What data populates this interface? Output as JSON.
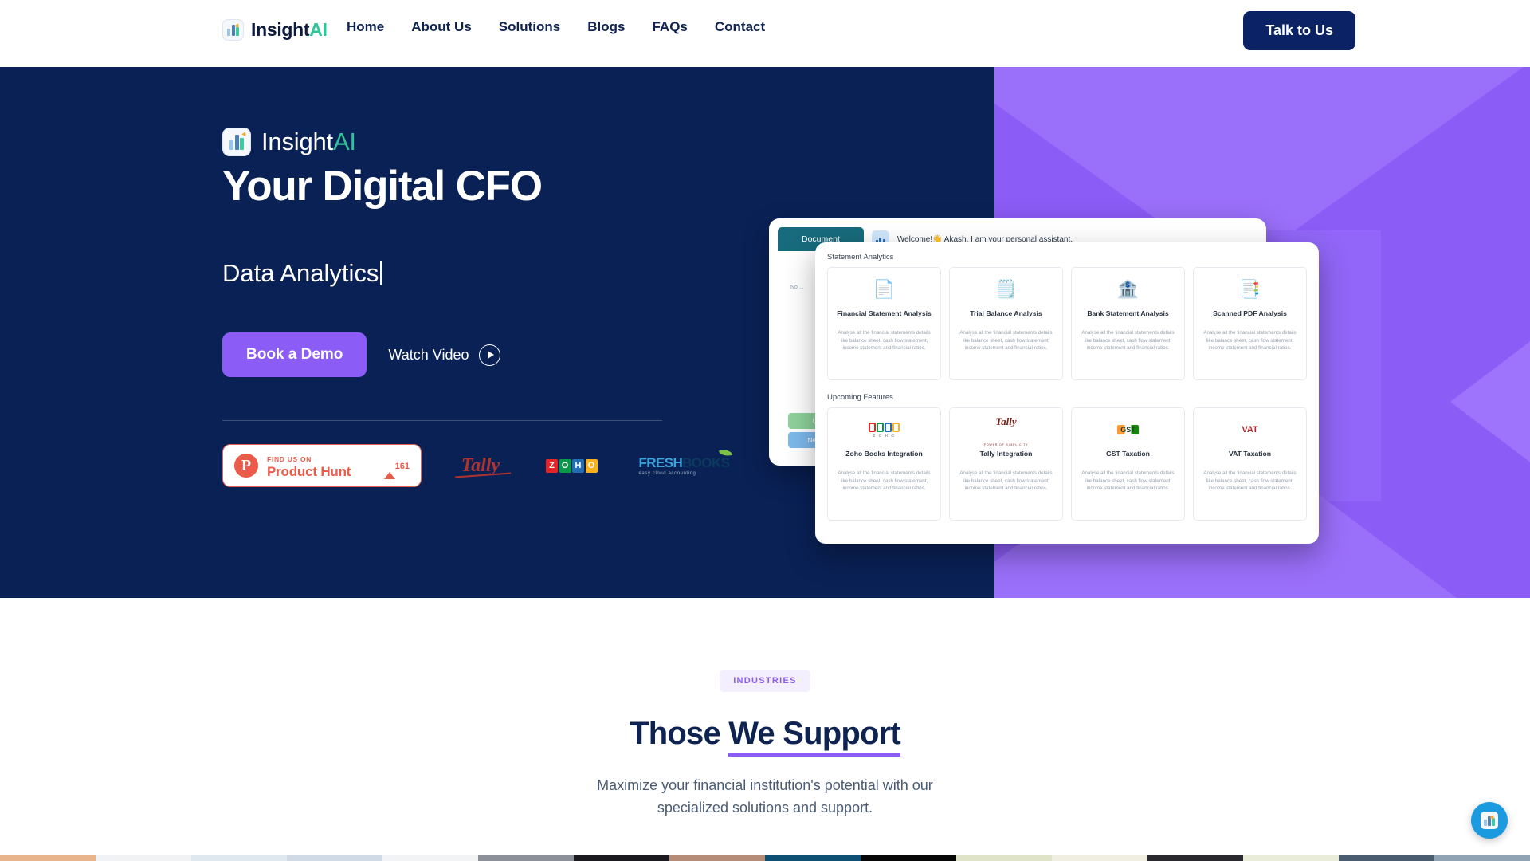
{
  "brand": {
    "name_main": "Insight",
    "name_accent": "AI"
  },
  "nav": {
    "links": [
      {
        "label": "Home"
      },
      {
        "label": "About Us"
      },
      {
        "label": "Solutions"
      },
      {
        "label": "Blogs"
      },
      {
        "label": "FAQs"
      },
      {
        "label": "Contact"
      }
    ],
    "cta": "Talk to Us"
  },
  "hero": {
    "title": "Your Digital CFO",
    "typed_text": "Data Analytics",
    "primary_cta": "Book a Demo",
    "secondary_cta": "Watch Video",
    "product_hunt": {
      "small": "FIND US ON",
      "big": "Product Hunt",
      "count": "161"
    },
    "partners": [
      {
        "name": "Tally",
        "label": "Tally"
      },
      {
        "name": "Zoho",
        "letters": [
          "Z",
          "O",
          "H",
          "O"
        ]
      },
      {
        "name": "FreshBooks",
        "fresh": "FRESH",
        "books": "BOOKS",
        "tagline": "easy cloud accounting"
      }
    ]
  },
  "mockup": {
    "tab_label": "Document",
    "welcome": "Welcome!👋 Akash. I am your personal assistant.",
    "side_hint": "No ...",
    "btn_green": "U...",
    "btn_blue": "New ...",
    "sections": [
      {
        "title": "Statement Analytics",
        "cards": [
          {
            "icon": "document-chart-icon",
            "glyph": "📄",
            "title": "Financial Statement Analysis",
            "desc": "Analyse all the financial statements details like balance sheet, cash flow statement, income statement and financial ratios."
          },
          {
            "icon": "trial-balance-icon",
            "glyph": "🗒️",
            "title": "Trial Balance Analysis",
            "desc": "Analyse all the financial statements details like balance sheet, cash flow statement, income statement and financial ratios."
          },
          {
            "icon": "bank-statement-icon",
            "glyph": "🏦",
            "title": "Bank Statement Analysis",
            "desc": "Analyse all the financial statements details like balance sheet, cash flow statement, income statement and financial ratios."
          },
          {
            "icon": "scanned-pdf-icon",
            "glyph": "📑",
            "title": "Scanned PDF Analysis",
            "desc": "Analyse all the financial statements details like balance sheet, cash flow statement, income statement and financial ratios."
          }
        ]
      },
      {
        "title": "Upcoming Features",
        "cards": [
          {
            "icon": "zoho-logo-icon",
            "glyph": "",
            "title": "Zoho Books Integration",
            "desc": "Analyse all the financial statements details like balance sheet, cash flow statement, income statement and financial ratios."
          },
          {
            "icon": "tally-logo-icon",
            "glyph": "",
            "title": "Tally Integration",
            "desc": "Analyse all the financial statements details like balance sheet, cash flow statement, income statement and financial ratios."
          },
          {
            "icon": "gst-logo-icon",
            "glyph": "",
            "title": "GST Taxation",
            "desc": "Analyse all the financial statements details like balance sheet, cash flow statement, income statement and financial ratios."
          },
          {
            "icon": "vat-logo-icon",
            "glyph": "",
            "title": "VAT Taxation",
            "desc": "Analyse all the financial statements details like balance sheet, cash flow statement, income statement and financial ratios."
          }
        ]
      }
    ],
    "zoho_caption": "Z O H O",
    "tally_caption": "POWER OF SIMPLICITY",
    "gst_label": "GST",
    "vat_label": "VAT"
  },
  "industries": {
    "badge": "INDUSTRIES",
    "title_plain": "Those ",
    "title_underlined": "We Support",
    "subtitle": "Maximize your financial institution's potential with our specialized solutions and support."
  },
  "colors": {
    "navy": "#0a2156",
    "purple": "#8b5cf6",
    "teal": "#2fc49a",
    "product_hunt_red": "#ea5b4a",
    "chat_blue": "#1c9ae0"
  },
  "strip_colors": [
    "#e8b48c",
    "#f0f2f4",
    "#dfe7ef",
    "#cfdae6",
    "#f2f3f5",
    "#8c9098",
    "#1b1b1f",
    "#b58c78",
    "#0e4f74",
    "#070708",
    "#dfe4c8",
    "#efeee0",
    "#2a2a2e",
    "#e8ecd8",
    "#4a5c70",
    "#8fa3b5"
  ]
}
